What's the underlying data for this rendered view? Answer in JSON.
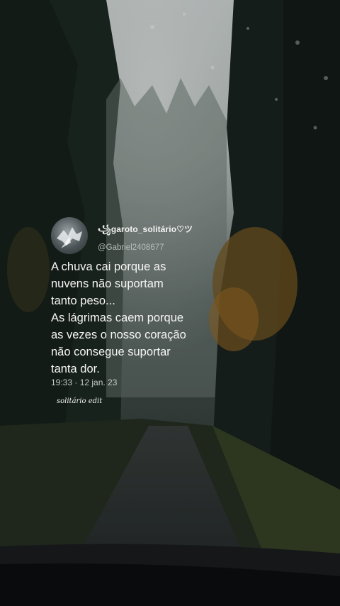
{
  "tweet": {
    "display_name": "꧁garoto_solitário♡ツ",
    "username": "@Gabriel2408677",
    "body": "A chuva cai porque as\nnuvens não suportam\ntanto peso...\nAs lágrimas caem porque\nas vezes o nosso coração\nnão consegue suportar\ntanta dor.",
    "timestamp": "19:33 · 12 jan. 23"
  },
  "watermark": "solitário edit"
}
